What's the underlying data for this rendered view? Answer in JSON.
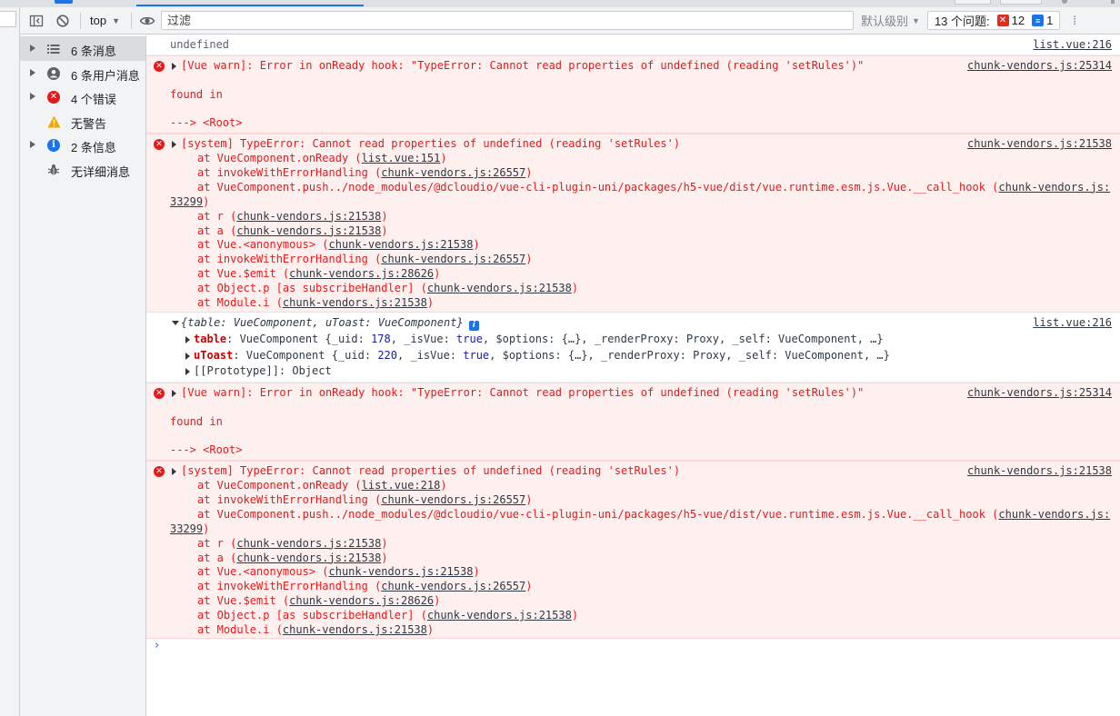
{
  "toolbar": {
    "context": "top",
    "filter_placeholder": "过滤",
    "levels": "默认级别",
    "issues_label": "13 个问题:",
    "issues_errors": "12",
    "issues_info": "1"
  },
  "sidebar": {
    "items": [
      {
        "label": "6 条消息"
      },
      {
        "label": "6 条用户消息"
      },
      {
        "label": "4 个错误"
      },
      {
        "label": "无警告"
      },
      {
        "label": "2 条信息"
      },
      {
        "label": "无详细消息"
      }
    ]
  },
  "console": {
    "log1": {
      "text": "undefined",
      "src": "list.vue:216"
    },
    "warn1": {
      "text": "[Vue warn]: Error in onReady hook: \"TypeError: Cannot read properties of undefined (reading 'setRules')\"",
      "src": "chunk-vendors.js:25314",
      "found": "found in",
      "root": "---> <Root>"
    },
    "err1": {
      "text": "[system] TypeError: Cannot read properties of undefined (reading 'setRules')",
      "src": "chunk-vendors.js:21538",
      "frames": [
        {
          "prefix": "at VueComponent.onReady (",
          "link": "list.vue:151",
          "suffix": ")"
        },
        {
          "prefix": "at invokeWithErrorHandling (",
          "link": "chunk-vendors.js:26557",
          "suffix": ")"
        },
        {
          "prefix": "at VueComponent.push../node_modules/@dcloudio/vue-cli-plugin-uni/packages/h5-vue/dist/vue.runtime.esm.js.Vue.__call_hook (",
          "link": "chunk-vendors.js:",
          "suffix": ""
        },
        {
          "prefix": "",
          "link": "33299",
          "suffix": ")"
        },
        {
          "prefix": "at r (",
          "link": "chunk-vendors.js:21538",
          "suffix": ")"
        },
        {
          "prefix": "at a (",
          "link": "chunk-vendors.js:21538",
          "suffix": ")"
        },
        {
          "prefix": "at Vue.<anonymous> (",
          "link": "chunk-vendors.js:21538",
          "suffix": ")"
        },
        {
          "prefix": "at invokeWithErrorHandling (",
          "link": "chunk-vendors.js:26557",
          "suffix": ")"
        },
        {
          "prefix": "at Vue.$emit (",
          "link": "chunk-vendors.js:28626",
          "suffix": ")"
        },
        {
          "prefix": "at Object.p [as subscribeHandler] (",
          "link": "chunk-vendors.js:21538",
          "suffix": ")"
        },
        {
          "prefix": "at Module.i (",
          "link": "chunk-vendors.js:21538",
          "suffix": ")"
        }
      ]
    },
    "obj": {
      "summary": "{table: VueComponent, uToast: VueComponent}",
      "src": "list.vue:216",
      "props": [
        {
          "key": "table",
          "val_a": ": VueComponent {_uid: ",
          "num": "178",
          "val_b": ", _isVue: ",
          "bool": "true",
          "val_c": ", $options: {…}, _renderProxy: Proxy, _self: VueComponent, …}"
        },
        {
          "key": "uToast",
          "val_a": ": VueComponent {_uid: ",
          "num": "220",
          "val_b": ", _isVue: ",
          "bool": "true",
          "val_c": ", $options: {…}, _renderProxy: Proxy, _self: VueComponent, …}"
        }
      ],
      "proto": "[[Prototype]]: Object"
    },
    "warn2": {
      "text": "[Vue warn]: Error in onReady hook: \"TypeError: Cannot read properties of undefined (reading 'setRules')\"",
      "src": "chunk-vendors.js:25314",
      "found": "found in",
      "root": "---> <Root>"
    },
    "err2": {
      "text": "[system] TypeError: Cannot read properties of undefined (reading 'setRules')",
      "src": "chunk-vendors.js:21538",
      "frames": [
        {
          "prefix": "at VueComponent.onReady (",
          "link": "list.vue:218",
          "suffix": ")"
        },
        {
          "prefix": "at invokeWithErrorHandling (",
          "link": "chunk-vendors.js:26557",
          "suffix": ")"
        },
        {
          "prefix": "at VueComponent.push../node_modules/@dcloudio/vue-cli-plugin-uni/packages/h5-vue/dist/vue.runtime.esm.js.Vue.__call_hook (",
          "link": "chunk-vendors.js:",
          "suffix": ""
        },
        {
          "prefix": "",
          "link": "33299",
          "suffix": ")"
        },
        {
          "prefix": "at r (",
          "link": "chunk-vendors.js:21538",
          "suffix": ")"
        },
        {
          "prefix": "at a (",
          "link": "chunk-vendors.js:21538",
          "suffix": ")"
        },
        {
          "prefix": "at Vue.<anonymous> (",
          "link": "chunk-vendors.js:21538",
          "suffix": ")"
        },
        {
          "prefix": "at invokeWithErrorHandling (",
          "link": "chunk-vendors.js:26557",
          "suffix": ")"
        },
        {
          "prefix": "at Vue.$emit (",
          "link": "chunk-vendors.js:28626",
          "suffix": ")"
        },
        {
          "prefix": "at Object.p [as subscribeHandler] (",
          "link": "chunk-vendors.js:21538",
          "suffix": ")"
        },
        {
          "prefix": "at Module.i (",
          "link": "chunk-vendors.js:21538",
          "suffix": ")"
        }
      ]
    },
    "prompt": "›"
  },
  "colors": {
    "error_text": "#e41a1a",
    "error_bg": "#fff0f0",
    "accent": "#1a73e8",
    "warn": "#f2a600"
  },
  "icons": {
    "sidebar": [
      "list-icon",
      "user-icon",
      "error-icon",
      "warning-icon",
      "info-icon",
      "bug-icon"
    ]
  }
}
